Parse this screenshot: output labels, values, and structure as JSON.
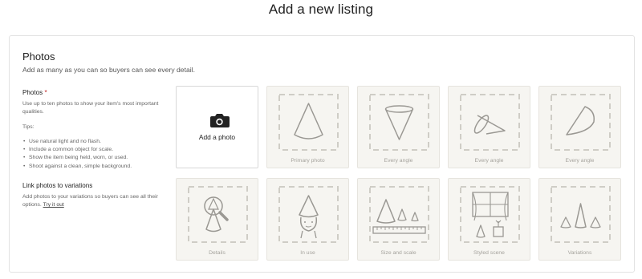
{
  "page": {
    "title": "Add a new listing"
  },
  "photos_section": {
    "title": "Photos",
    "subtitle": "Add as many as you can so buyers can see every detail.",
    "photos_heading": "Photos",
    "required_mark": "*",
    "photos_help": "Use up to ten photos to show your item's most important qualities.",
    "tips_label": "Tips:",
    "tips": [
      "Use natural light and no flash.",
      "Include a common object for scale.",
      "Show the item being held, worn, or used.",
      "Shoot against a clean, simple background."
    ],
    "link_heading": "Link photos to variations",
    "link_help": "Add photos to your variations so buyers can see all their options.",
    "link_label": "Try it out"
  },
  "add_tile": {
    "label": "Add a photo",
    "icon": "camera-icon"
  },
  "tiles": [
    {
      "caption": "Primary photo",
      "icon": "cone-upright-icon"
    },
    {
      "caption": "Every angle",
      "icon": "cone-inverted-icon"
    },
    {
      "caption": "Every angle",
      "icon": "cone-tilted-icon"
    },
    {
      "caption": "Every angle",
      "icon": "cone-side-icon"
    },
    {
      "caption": "Details",
      "icon": "magnifier-cone-icon"
    },
    {
      "caption": "In use",
      "icon": "cone-hat-person-icon"
    },
    {
      "caption": "Size and scale",
      "icon": "cones-ruler-icon"
    },
    {
      "caption": "Styled scene",
      "icon": "window-scene-icon"
    },
    {
      "caption": "Variations",
      "icon": "cone-variants-icon"
    }
  ],
  "colors": {
    "tile_bg": "#f6f5f1",
    "art_stroke": "#9a9893",
    "dash": "#cfcdc6",
    "caption": "#a5a39d"
  }
}
